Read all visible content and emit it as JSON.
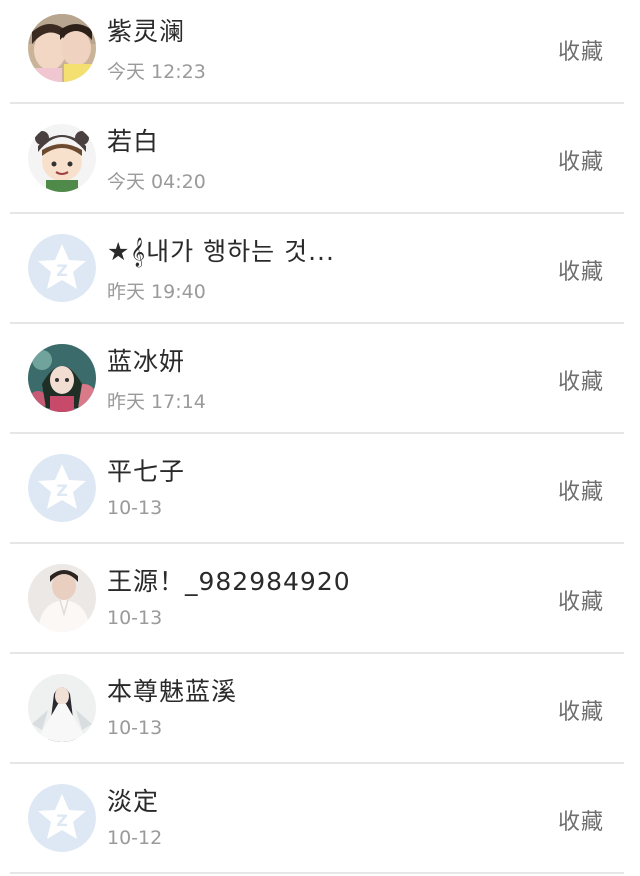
{
  "colors": {
    "divider": "#e6e6e6",
    "name_text": "#2a2a2a",
    "time_text": "#9a9a9a",
    "action_text": "#6e6e6e",
    "default_avatar_bg": "#dde8f4",
    "default_avatar_star": "#ffffff"
  },
  "items": [
    {
      "name": "紫灵澜",
      "time": "今天 12:23",
      "action": "收藏",
      "avatar": "photo-two-girls"
    },
    {
      "name": "若白",
      "time": "今天 04:20",
      "action": "收藏",
      "avatar": "cartoon-boy-panda-hat"
    },
    {
      "name": "★𝄞내가 행하는 것...",
      "time": "昨天 19:40",
      "action": "收藏",
      "avatar": "default-qq-star"
    },
    {
      "name": "蓝冰妍",
      "time": "昨天 17:14",
      "action": "收藏",
      "avatar": "anime-girl"
    },
    {
      "name": "平七子",
      "time": "10-13",
      "action": "收藏",
      "avatar": "default-qq-star"
    },
    {
      "name": "王源！_982984920",
      "time": "10-13",
      "action": "收藏",
      "avatar": "photo-boy-white-shirt"
    },
    {
      "name": "本尊魅蓝溪",
      "time": "10-13",
      "action": "收藏",
      "avatar": "anime-figure-white-robe"
    },
    {
      "name": "淡定",
      "time": "10-12",
      "action": "收藏",
      "avatar": "default-qq-star"
    }
  ]
}
